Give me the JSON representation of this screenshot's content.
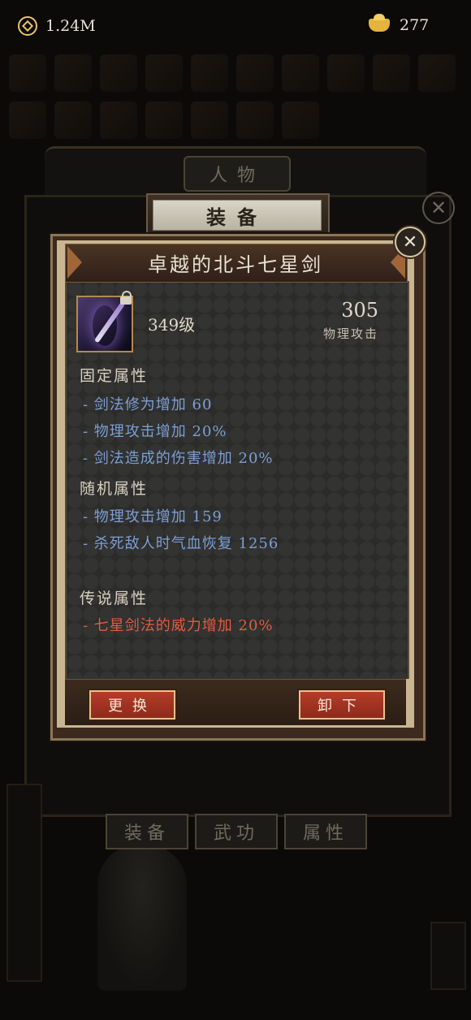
{
  "topbar": {
    "currency": "1.24M",
    "ingots": "277"
  },
  "background": {
    "title": "人物",
    "tabs": [
      "装备",
      "武功",
      "属性"
    ]
  },
  "modal": {
    "header": "装备",
    "item_name": "卓越的北斗七星剑",
    "level": "349级",
    "power_value": "305",
    "power_label": "物理攻击",
    "fixed_title": "固定属性",
    "fixed_attrs": [
      "- 剑法修为增加 60",
      "- 物理攻击增加 20%",
      "- 剑法造成的伤害增加 20%"
    ],
    "random_title": "随机属性",
    "random_attrs": [
      "- 物理攻击增加 159",
      "- 杀死敌人时气血恢复 1256"
    ],
    "legend_title": "传说属性",
    "legend_attrs": [
      "- 七星剑法的威力增加 20%"
    ],
    "replace_label": "更换",
    "unequip_label": "卸下"
  },
  "colors": {
    "attr_blue": "#7c9fd4",
    "legend_red": "#e35d3f",
    "button_red": "#a33423",
    "panel_bg": "#2b2b2a"
  },
  "icons": {
    "currency": "coin-icon",
    "ingot": "gold-ingot-icon",
    "close": "close-icon",
    "lock": "lock-icon",
    "item": "sword-icon"
  }
}
